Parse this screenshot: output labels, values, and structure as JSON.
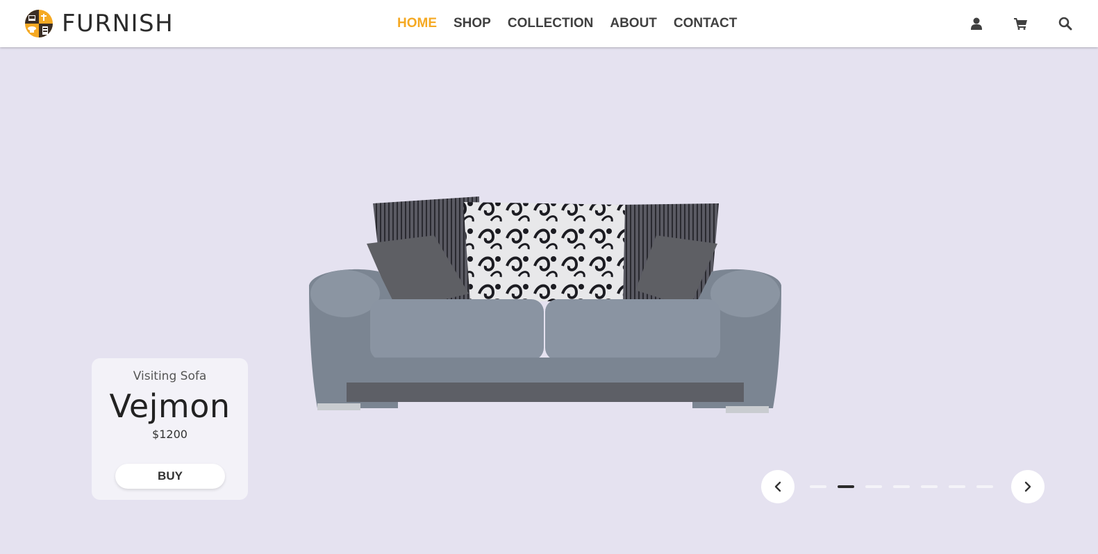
{
  "brand": {
    "name": "FURNISH",
    "logo_icon": "furniture-logo-icon"
  },
  "nav": {
    "items": [
      {
        "label": "HOME",
        "active": true
      },
      {
        "label": "SHOP",
        "active": false
      },
      {
        "label": "COLLECTION",
        "active": false
      },
      {
        "label": "ABOUT",
        "active": false
      },
      {
        "label": "CONTACT",
        "active": false
      }
    ],
    "active_color": "#f5a923",
    "icons": [
      "user-icon",
      "cart-icon",
      "search-icon"
    ]
  },
  "hero": {
    "background": "#e5e2f0",
    "product": {
      "category": "Visiting Sofa",
      "name": "Vejmon",
      "price": "$1200",
      "buy_label": "BUY"
    },
    "carousel": {
      "slide_count": 7,
      "active_index": 1,
      "prev_icon": "chevron-left-icon",
      "next_icon": "chevron-right-icon"
    }
  }
}
